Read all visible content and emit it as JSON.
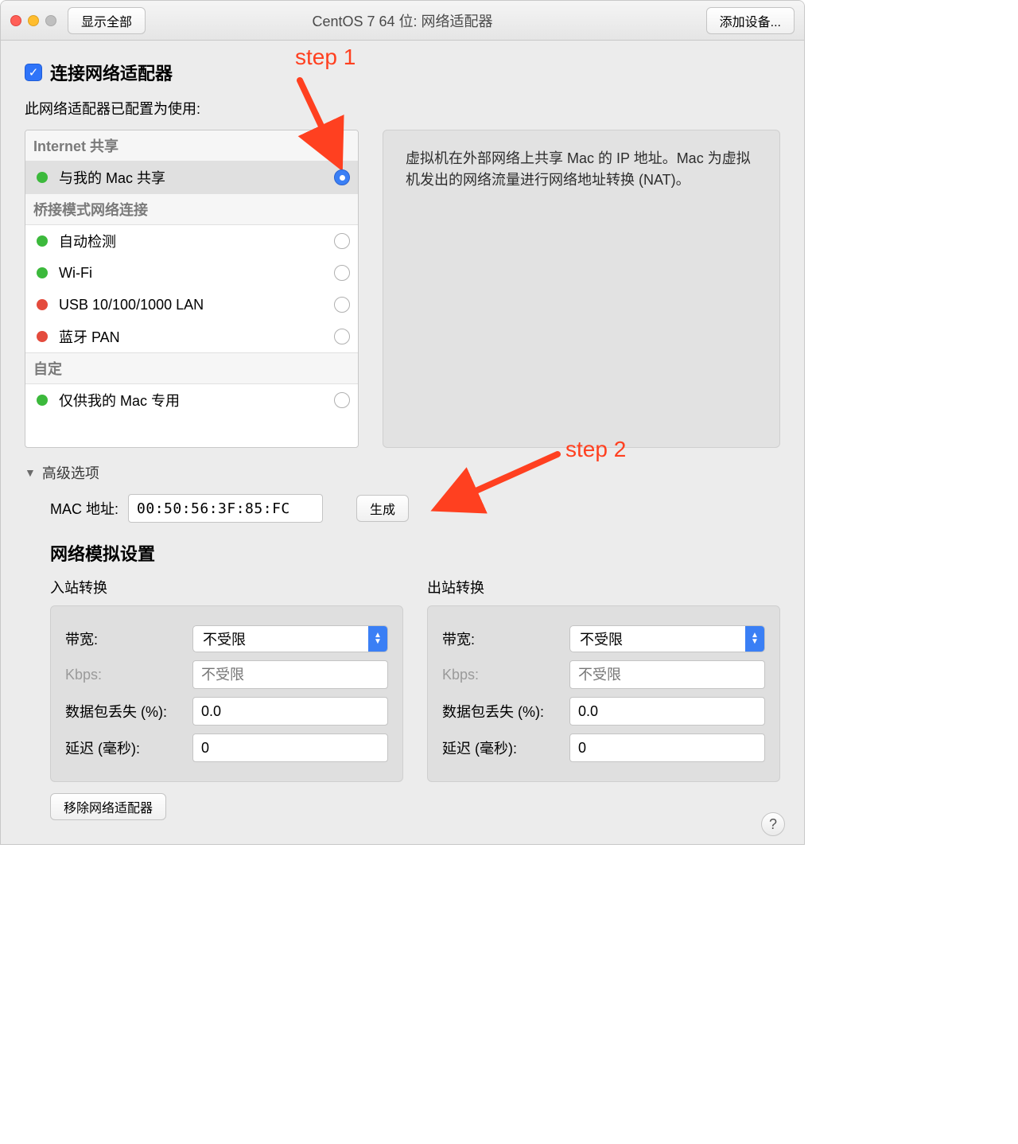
{
  "titlebar": {
    "show_all": "显示全部",
    "title": "CentOS 7 64 位: 网络适配器",
    "add_device": "添加设备..."
  },
  "main": {
    "connect_checkbox_label": "连接网络适配器",
    "configured_text": "此网络适配器已配置为使用:",
    "net_list": {
      "section_internet": "Internet 共享",
      "share_mac": "与我的 Mac 共享",
      "section_bridged": "桥接模式网络连接",
      "autodetect": "自动检测",
      "wifi": "Wi-Fi",
      "usb_lan": "USB 10/100/1000 LAN",
      "bt_pan": "蓝牙 PAN",
      "section_custom": "自定",
      "private_mac": "仅供我的 Mac 专用"
    },
    "info_panel_text": "虚拟机在外部网络上共享 Mac 的 IP 地址。Mac 为虚拟机发出的网络流量进行网络地址转换 (NAT)。",
    "advanced_label": "高级选项",
    "mac_label": "MAC 地址:",
    "mac_value": "00:50:56:3F:85:FC",
    "generate_btn": "生成",
    "sim_title": "网络模拟设置",
    "sim_in_title": "入站转换",
    "sim_out_title": "出站转换",
    "sim": {
      "bandwidth_label": "带宽:",
      "bandwidth_value": "不受限",
      "kbps_label": "Kbps:",
      "kbps_placeholder": "不受限",
      "loss_label": "数据包丢失 (%):",
      "loss_value": "0.0",
      "latency_label": "延迟 (毫秒):",
      "latency_value": "0"
    },
    "remove_btn": "移除网络适配器",
    "help": "?"
  },
  "annotations": {
    "step1": "step 1",
    "step2": "step 2"
  }
}
